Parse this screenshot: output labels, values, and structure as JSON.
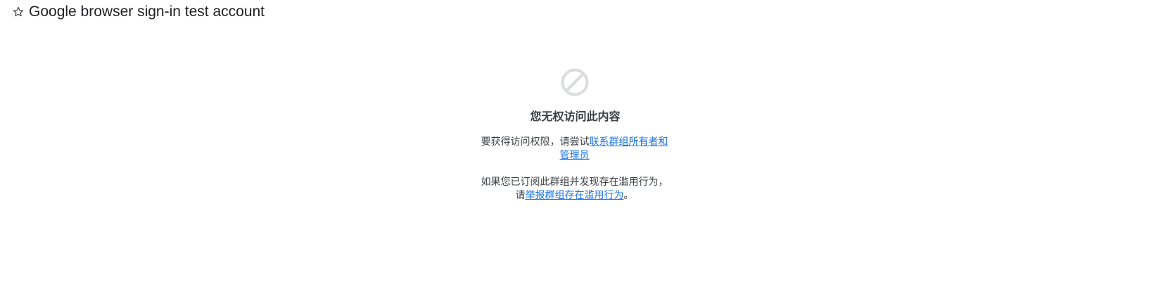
{
  "header": {
    "star_icon": "star-outline-icon",
    "title": "Google browser sign-in test account"
  },
  "main": {
    "block_icon": "block-icon",
    "heading": "您无权访问此内容",
    "access": {
      "prefix": "要获得访问权限，请尝试",
      "link": "联系群组所有者和管理员"
    },
    "report": {
      "line1": "如果您已订阅此群组并发现存在滥用行为，",
      "prefix": "请",
      "link": "举报群组存在滥用行为",
      "suffix": "。"
    }
  },
  "colors": {
    "link": "#1a73e8",
    "icon": "#dadce0",
    "text": "#3c4043"
  }
}
